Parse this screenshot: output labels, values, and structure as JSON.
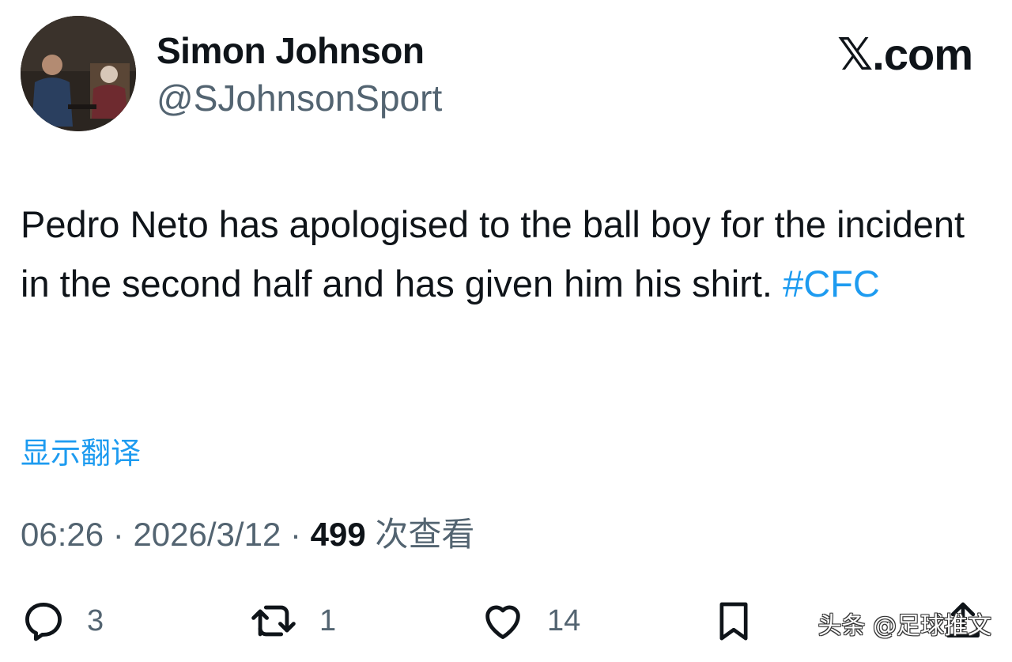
{
  "author": {
    "display_name": "Simon Johnson",
    "handle": "@SJohnsonSport"
  },
  "brand": {
    "glyph": "𝕏",
    "suffix": ".com"
  },
  "tweet": {
    "text": "Pedro Neto has apologised to the ball boy for the incident in the second half and has given him his shirt.",
    "hashtag": "#CFC",
    "translate_label": "显示翻译"
  },
  "meta": {
    "time": "06:26",
    "separator": "·",
    "date": "2026/3/12",
    "views_count": "499",
    "views_label": "次查看"
  },
  "actions": {
    "reply_count": "3",
    "retweet_count": "1",
    "like_count": "14"
  },
  "watermark": "头条 @足球推文",
  "icons": {
    "reply": "reply-icon",
    "retweet": "retweet-icon",
    "like": "heart-icon",
    "bookmark": "bookmark-icon",
    "share": "share-icon"
  },
  "colors": {
    "accent": "#1d9bf0",
    "muted": "#536471",
    "text": "#0f1419"
  }
}
